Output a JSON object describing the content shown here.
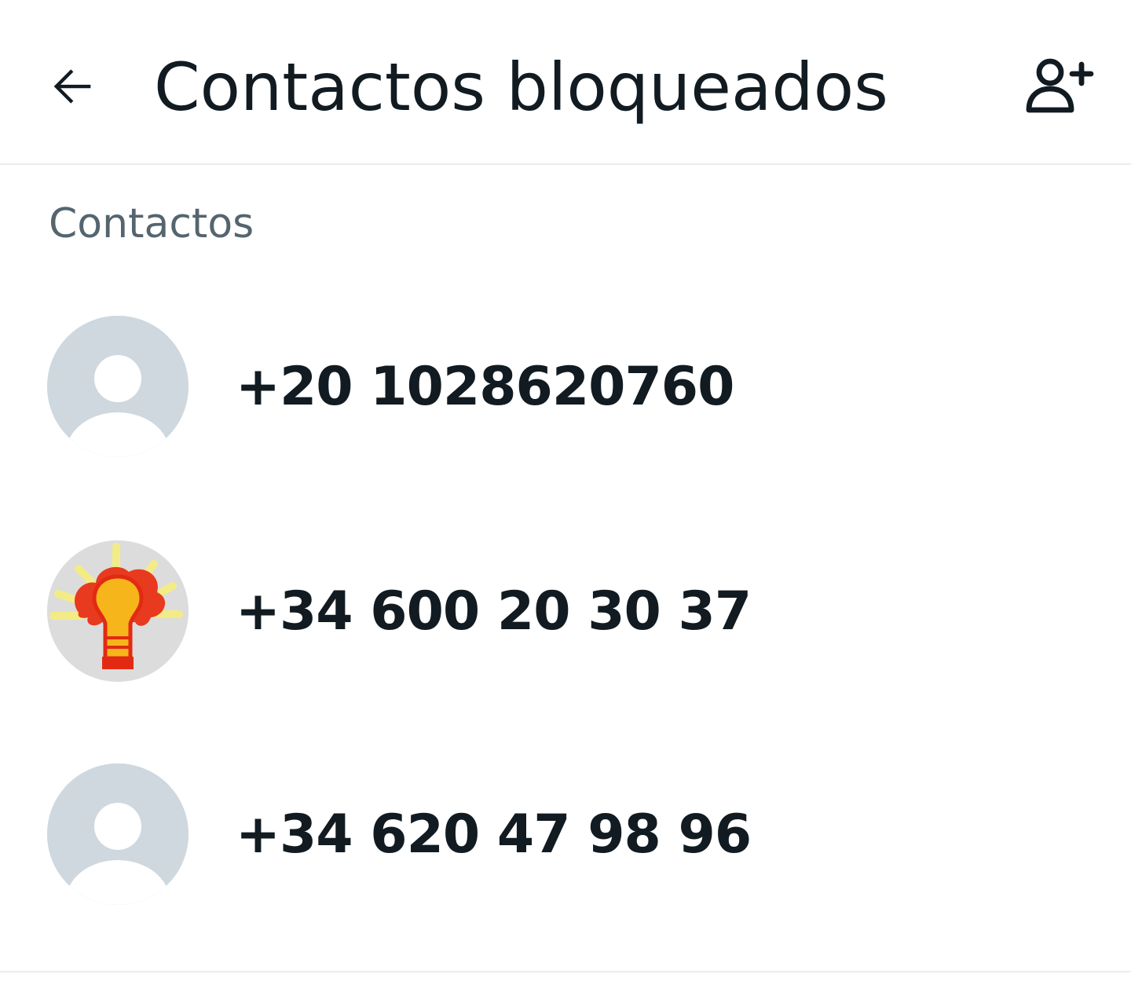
{
  "header": {
    "title": "Contactos bloqueados",
    "back_icon": "arrow-left-icon",
    "add_icon": "person-add-icon"
  },
  "section": {
    "label": "Contactos"
  },
  "contacts": [
    {
      "name": "+20 1028620760",
      "avatar": "default-avatar-icon"
    },
    {
      "name": "+34 600 20 30 37",
      "avatar": "lightbulb-avatar"
    },
    {
      "name": "+34 620 47 98 96",
      "avatar": "default-avatar-icon"
    }
  ],
  "colors": {
    "primary_text": "#111b21",
    "secondary_text": "#54656f",
    "avatar_bg": "#cfd8de",
    "divider": "#e9edef"
  }
}
